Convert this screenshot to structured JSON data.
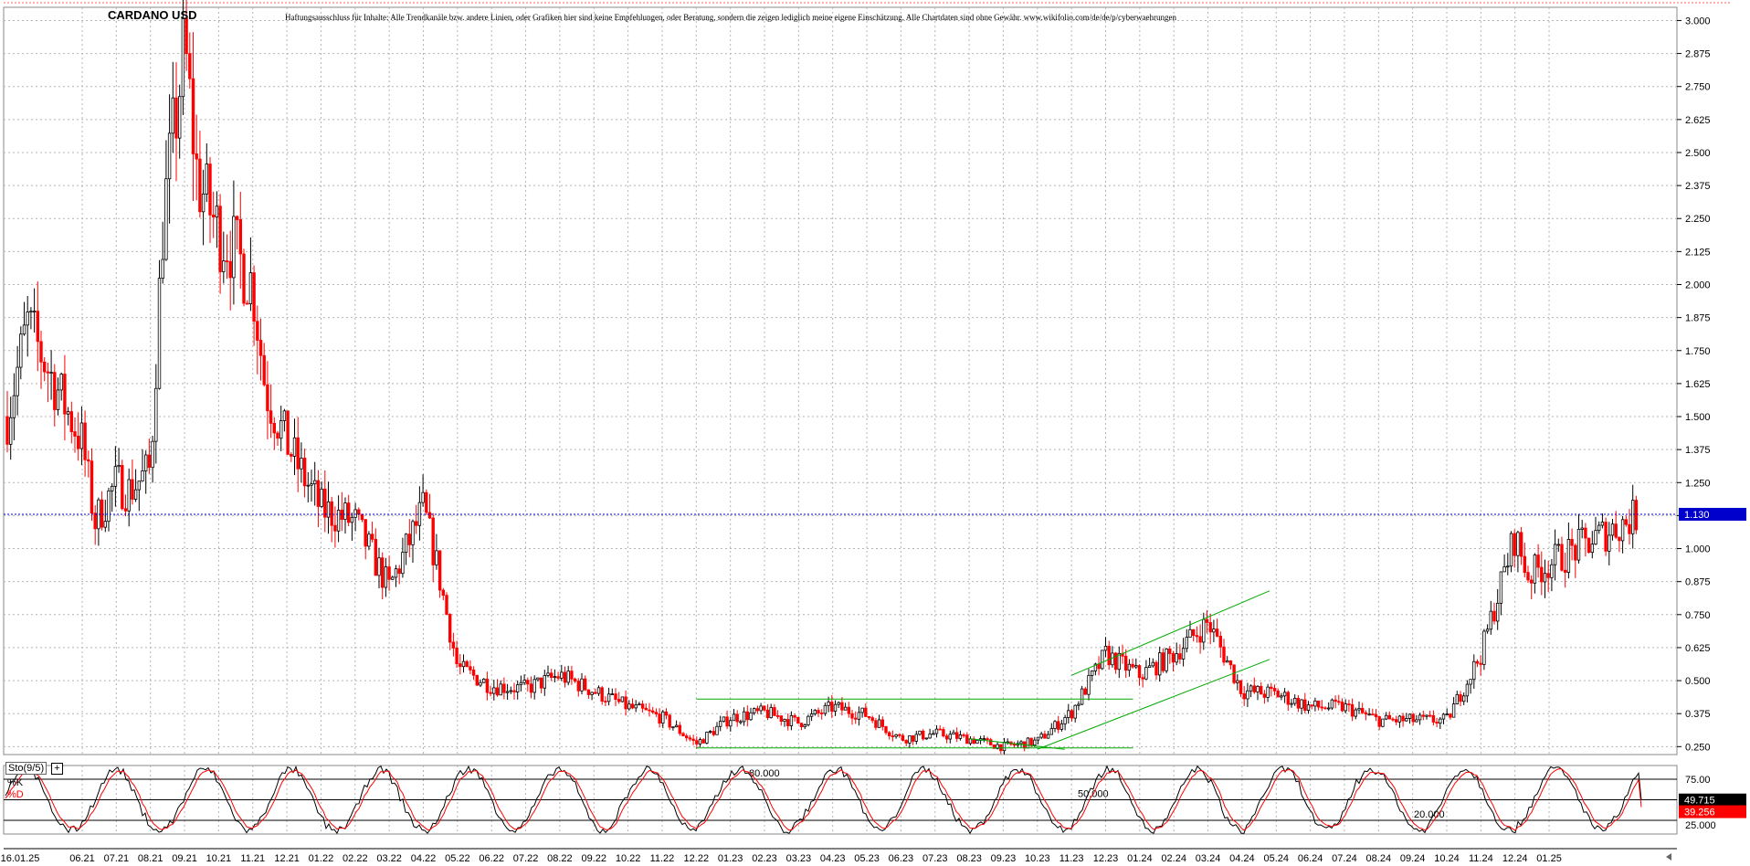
{
  "header": {
    "title": "CARDANO USD",
    "disclaimer": "Haftungsausschluss für Inhalte: Alle Trendkanäle bzw. andere Linien, oder Grafiken hier sind keine Empfehlungen, oder Beratung, sondern die zeigen lediglich meine eigene Einschätzung. Alle Chartdaten sind ohne Gewähr.  www.wikifolio.com/de/de/p/cyberwaehrungen"
  },
  "stochastic": {
    "title": "Sto(9/5)",
    "k_label": "%K",
    "d_label": "%D",
    "levels": [
      "80.000",
      "50.000",
      "20.000"
    ],
    "axis_ticks": [
      "75.00",
      "25.000"
    ],
    "k_value": "49.715",
    "d_value": "39.256"
  },
  "colors": {
    "up_candle": "#000000",
    "down_candle": "#ff0000",
    "trendline": "#00aa00",
    "current_price_line": "#0000cc",
    "price_tag_bg": "#0000cc",
    "d_tag_bg": "#ff0000",
    "grid": "#b4b4b4"
  },
  "chart_data": [
    {
      "type": "candlestick",
      "title": "CARDANO USD",
      "y_axis_ticks": [
        "3.000",
        "2.875",
        "2.750",
        "2.625",
        "2.500",
        "2.375",
        "2.250",
        "2.125",
        "2.000",
        "1.875",
        "1.750",
        "1.625",
        "1.500",
        "1.375",
        "1.250",
        "1.125",
        "1.000",
        "0.875",
        "0.750",
        "0.625",
        "0.500",
        "0.375",
        "0.250"
      ],
      "x_axis_ticks": [
        "16.01.25",
        "06.21",
        "07.21",
        "08.21",
        "09.21",
        "10.21",
        "11.21",
        "12.21",
        "01.22",
        "02.22",
        "03.22",
        "04.22",
        "05.22",
        "06.22",
        "07.22",
        "08.22",
        "09.22",
        "10.22",
        "11.22",
        "12.22",
        "01.23",
        "02.23",
        "03.23",
        "04.23",
        "05.23",
        "06.23",
        "07.23",
        "08.23",
        "09.23",
        "10.23",
        "11.23",
        "12.23",
        "01.24",
        "02.24",
        "03.24",
        "04.24",
        "05.24",
        "06.24",
        "07.24",
        "08.24",
        "09.24",
        "10.24",
        "11.24",
        "12.24",
        "01.25"
      ],
      "ylim": [
        0.22,
        3.05
      ],
      "current_price": "1.130",
      "grid": true,
      "close_path": [
        [
          "05.21",
          1.5
        ],
        [
          "05.21",
          1.85
        ],
        [
          "06.21",
          1.4
        ],
        [
          "06.21",
          1.1
        ],
        [
          "07.21",
          1.25
        ],
        [
          "07.21",
          1.22
        ],
        [
          "08.21",
          1.3
        ],
        [
          "08.21",
          2.25
        ],
        [
          "09.21",
          2.9
        ],
        [
          "09.21",
          2.4
        ],
        [
          "10.21",
          2.2
        ],
        [
          "10.21",
          2.15
        ],
        [
          "11.21",
          2.0
        ],
        [
          "11.21",
          1.6
        ],
        [
          "12.21",
          1.4
        ],
        [
          "12.21",
          1.3
        ],
        [
          "01.22",
          1.15
        ],
        [
          "02.22",
          1.1
        ],
        [
          "03.22",
          0.85
        ],
        [
          "04.22",
          1.15
        ],
        [
          "04.22",
          0.95
        ],
        [
          "05.22",
          0.55
        ],
        [
          "06.22",
          0.48
        ],
        [
          "07.22",
          0.47
        ],
        [
          "08.22",
          0.52
        ],
        [
          "09.22",
          0.46
        ],
        [
          "10.22",
          0.4
        ],
        [
          "11.22",
          0.36
        ],
        [
          "12.22",
          0.26
        ],
        [
          "01.23",
          0.36
        ],
        [
          "02.23",
          0.38
        ],
        [
          "03.23",
          0.34
        ],
        [
          "04.23",
          0.4
        ],
        [
          "05.23",
          0.37
        ],
        [
          "06.23",
          0.28
        ],
        [
          "07.23",
          0.3
        ],
        [
          "08.23",
          0.28
        ],
        [
          "09.23",
          0.25
        ],
        [
          "10.23",
          0.27
        ],
        [
          "11.23",
          0.38
        ],
        [
          "12.23",
          0.6
        ],
        [
          "01.24",
          0.52
        ],
        [
          "02.24",
          0.6
        ],
        [
          "03.24",
          0.72
        ],
        [
          "04.24",
          0.46
        ],
        [
          "05.24",
          0.45
        ],
        [
          "06.24",
          0.4
        ],
        [
          "07.24",
          0.4
        ],
        [
          "08.24",
          0.35
        ],
        [
          "09.24",
          0.35
        ],
        [
          "10.24",
          0.35
        ],
        [
          "11.24",
          0.6
        ],
        [
          "12.24",
          1.05
        ],
        [
          "12.24",
          0.9
        ],
        [
          "01.25",
          1.13
        ]
      ],
      "trendlines": [
        {
          "from": [
            "12.22",
            0.43
          ],
          "to": [
            "12.23",
            0.43
          ]
        },
        {
          "from": [
            "12.22",
            0.245
          ],
          "to": [
            "12.23",
            0.245
          ]
        },
        {
          "from": [
            "08.23",
            0.28
          ],
          "to": [
            "10.23",
            0.24
          ]
        },
        {
          "from": [
            "10.23",
            0.24
          ],
          "to": [
            "04.24",
            0.58
          ]
        },
        {
          "from": [
            "11.23",
            0.52
          ],
          "to": [
            "04.24",
            0.84
          ]
        }
      ]
    },
    {
      "type": "line",
      "title": "Sto(9/5)",
      "ylim": [
        0,
        100
      ],
      "reference_levels": [
        80,
        50,
        20
      ],
      "series": [
        {
          "name": "%K",
          "last_value": 49.715
        },
        {
          "name": "%D",
          "last_value": 39.256
        }
      ]
    }
  ]
}
